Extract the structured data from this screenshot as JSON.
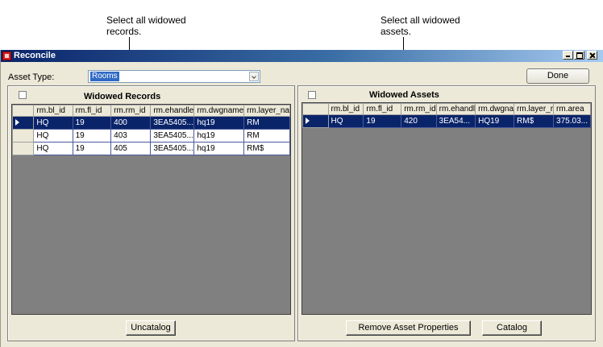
{
  "callouts": {
    "left": [
      "Select all widowed",
      "records."
    ],
    "right": [
      "Select all widowed",
      "assets."
    ]
  },
  "window": {
    "title": "Reconcile",
    "controls": [
      "minimize",
      "maximize",
      "close"
    ]
  },
  "asset_type": {
    "label": "Asset Type:",
    "value": "Rooms"
  },
  "done_label": "Done",
  "records_panel": {
    "title": "Widowed Records",
    "columns": [
      "rm.bl_id",
      "rm.fl_id",
      "rm.rm_id",
      "rm.ehandle",
      "rm.dwgname",
      "rm.layer_na"
    ],
    "rows": [
      [
        "HQ",
        "19",
        "400",
        "3EA5405...",
        "hq19",
        "RM"
      ],
      [
        "HQ",
        "19",
        "403",
        "3EA5405...",
        "hq19",
        "RM"
      ],
      [
        "HQ",
        "19",
        "405",
        "3EA5405...",
        "hq19",
        "RM$"
      ]
    ],
    "selected_row": 0,
    "uncatalog_label": "Uncatalog"
  },
  "assets_panel": {
    "title": "Widowed Assets",
    "columns": [
      "rm.bl_id",
      "rm.fl_id",
      "rm.rm_id",
      "rm.ehandl",
      "rm.dwgna",
      "rm.layer_r",
      "rm.area"
    ],
    "rows": [
      [
        "HQ",
        "19",
        "420",
        "3EA54...",
        "HQ19",
        "RM$",
        "375.03..."
      ]
    ],
    "selected_row": 0,
    "remove_label": "Remove Asset Properties",
    "catalog_label": "Catalog"
  },
  "colors": {
    "title_bar": "#0a246a",
    "window_bg": "#ece9d8",
    "grid_bg": "#808080",
    "selection": "#0a246a"
  }
}
